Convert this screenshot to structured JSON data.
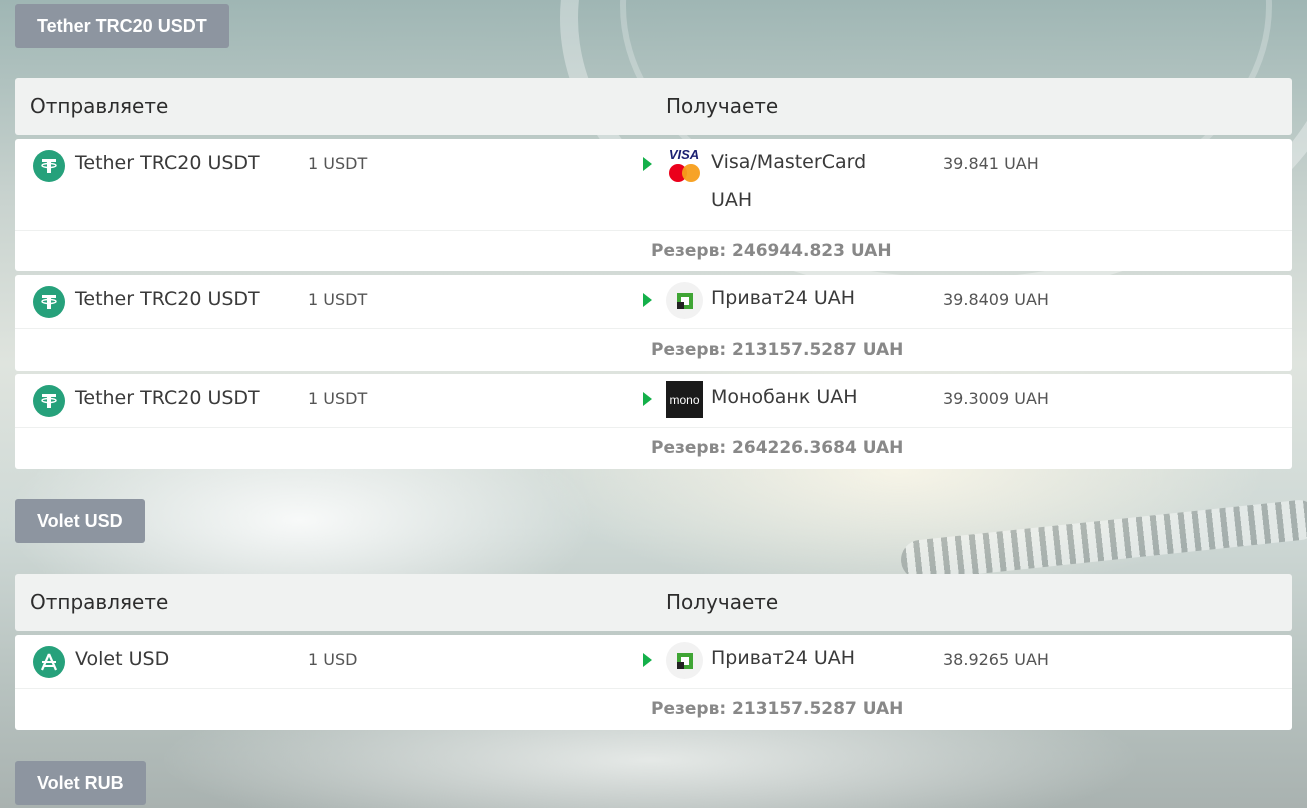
{
  "sections": [
    {
      "tag": "Tether TRC20 USDT",
      "header": {
        "send": "Отправляете",
        "receive": "Получаете"
      },
      "rows": [
        {
          "from_name": "Tether TRC20 USDT",
          "from_icon": "tether-icon",
          "from_amount": "1 USDT",
          "to_name": "Visa/MasterCard UAH",
          "to_icon": "visa-mastercard-icon",
          "to_amount": "39.841 UAH",
          "reserve": "Резерв: 246944.823 UAH"
        },
        {
          "from_name": "Tether TRC20 USDT",
          "from_icon": "tether-icon",
          "from_amount": "1 USDT",
          "to_name": "Приват24 UAH",
          "to_icon": "privat24-icon",
          "to_amount": "39.8409 UAH",
          "reserve": "Резерв: 213157.5287 UAH"
        },
        {
          "from_name": "Tether TRC20 USDT",
          "from_icon": "tether-icon",
          "from_amount": "1 USDT",
          "to_name": "Монобанк UAH",
          "to_icon": "monobank-icon",
          "to_amount": "39.3009 UAH",
          "reserve": "Резерв: 264226.3684 UAH"
        }
      ]
    },
    {
      "tag": "Volet USD",
      "header": {
        "send": "Отправляете",
        "receive": "Получаете"
      },
      "rows": [
        {
          "from_name": "Volet USD",
          "from_icon": "volet-icon",
          "from_amount": "1 USD",
          "to_name": "Приват24 UAH",
          "to_icon": "privat24-icon",
          "to_amount": "38.9265 UAH",
          "reserve": "Резерв: 213157.5287 UAH"
        }
      ]
    },
    {
      "tag": "Volet RUB"
    }
  ],
  "colors": {
    "accent_green": "#26a17b",
    "arrow_green": "#14b04a",
    "tag_gray": "#8d95a0",
    "header_bg": "#f0f2f1"
  },
  "mono_label": "mono",
  "visa_label": "VISA"
}
